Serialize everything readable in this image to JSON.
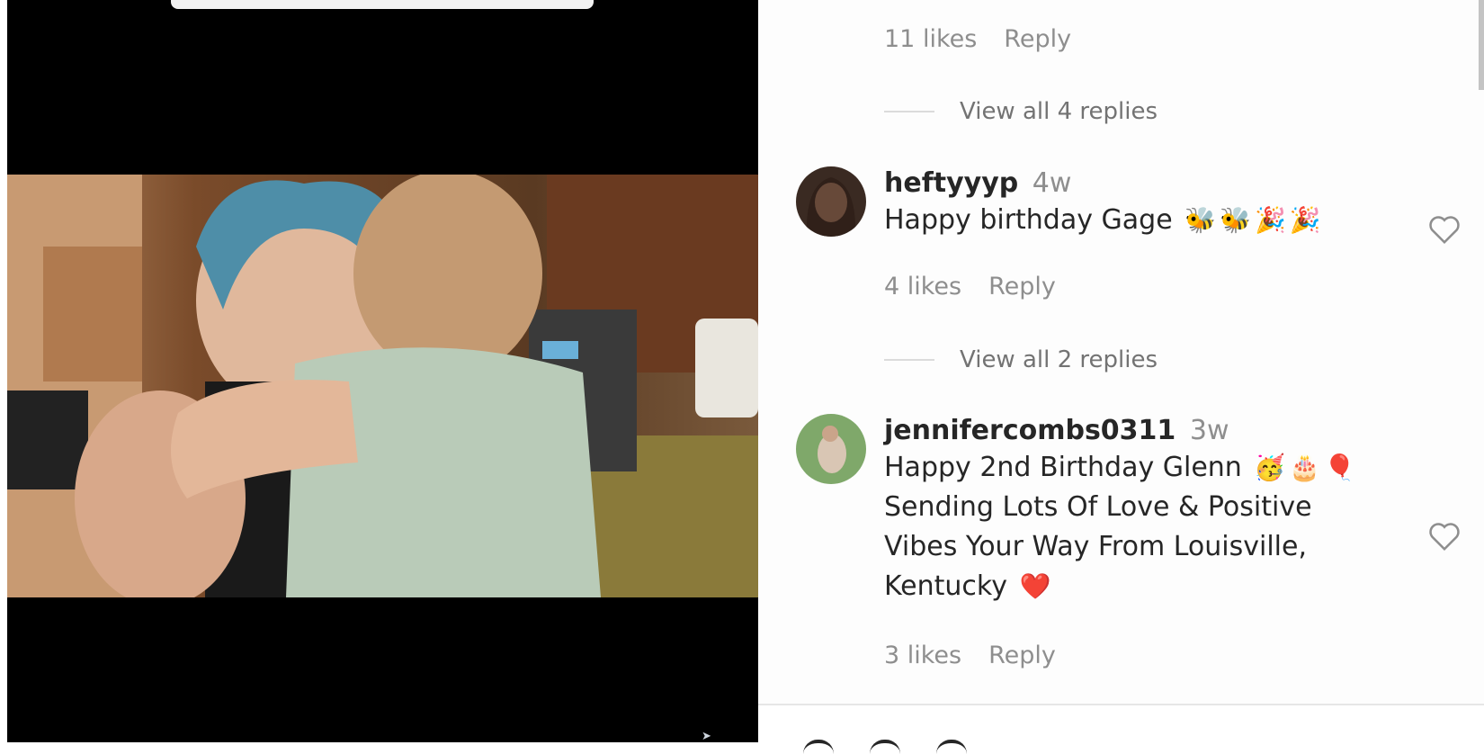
{
  "post": {
    "media_alt": "Woman holding toddler in kitchen"
  },
  "comments_panel": {
    "prev_meta": {
      "likes": "11 likes",
      "reply": "Reply"
    },
    "prev_view_replies": "View all 4 replies",
    "comments": [
      {
        "username": "heftyyyp",
        "time": "4w",
        "text": "Happy birthday Gage",
        "emojis": [
          "🐝",
          "🐝",
          "🎉",
          "🎉"
        ],
        "likes": "4 likes",
        "reply": "Reply",
        "view_replies": "View all 2 replies"
      },
      {
        "username": "jennifercombs0311",
        "time": "3w",
        "text_line1": "Happy 2nd Birthday Glenn",
        "emojis": [
          "🥳",
          "🎂",
          "🎈"
        ],
        "text_line2": "Sending Lots Of Love & Positive",
        "text_line3": "Vibes Your Way From Louisville,",
        "text_line4": "Kentucky",
        "trailing_emoji": "❤️",
        "likes": "3 likes",
        "reply": "Reply"
      }
    ]
  },
  "colors": {
    "accent_heart": "#e0182d",
    "meta_text": "#8e8e8e",
    "primary_text": "#262626"
  }
}
